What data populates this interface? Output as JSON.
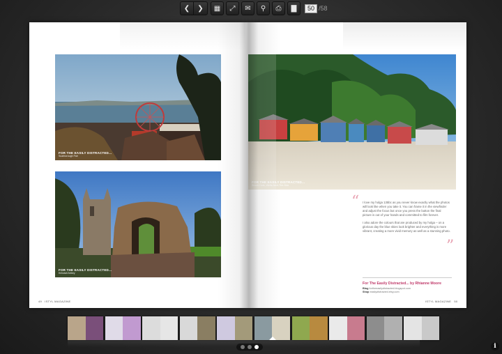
{
  "toolbar": {
    "prev_icon": "chevron-left-icon",
    "next_icon": "chevron-right-icon",
    "prev_glyph": "❮",
    "next_glyph": "❯",
    "grid_glyph": "▦",
    "fullscreen_glyph": "⤢",
    "email_glyph": "✉",
    "zoom_glyph": "⚲",
    "print_glyph": "⎙",
    "folder_glyph": "▇",
    "current_page": "50",
    "total_pages": "58"
  },
  "left_page": {
    "photo1_caption_title": "FOR THE EASILY DISTRACTED...",
    "photo1_caption_sub": "Scarborough Fair",
    "photo2_caption_title": "FOR THE EASILY DISTRACTED...",
    "photo2_caption_sub": "Kirkstall Abbey",
    "folio": "49",
    "magazine": "ISTYL MAGAZINE"
  },
  "right_page": {
    "photo_caption_title": "FOR THE EASILY DISTRACTED...",
    "photo_caption_sub": "Beach Huts, Wells-Next-The-Sea",
    "quote_open": "“",
    "quote_close": "”",
    "quote_p1": "I love my holga 135bc as you never know exactly what the photos will look like when you take it. You can frame it in the viewfinder and adjust the focus but once you press the button the final picture is out of your hands and committed to film forever.",
    "quote_p2": "I also adore the colours that are produced by my holga – on a glorious day the blue skies look brighter and everything is more vibrant, creating a more vivid memory as well as a stunning photo.",
    "byline": "For The Easily Distracted... by Rhianne Moore",
    "blog_label": "Blog",
    "blog_url": "fortheeasilydistracted.blogspot.com",
    "shop_label": "Shop",
    "shop_url": "easilydistracted.etsy.com",
    "magazine": "ISTYL MAGAZINE",
    "folio": "50"
  },
  "thumbnails": [
    {
      "left": "#b9a58a",
      "right": "#7a4f7a"
    },
    {
      "left": "#e0dbe8",
      "right": "#c19ad0"
    },
    {
      "left": "#dcdcdc",
      "right": "#e6e6e6"
    },
    {
      "left": "#d9d9d9",
      "right": "#8a7e62"
    },
    {
      "left": "#cfc9e0",
      "right": "#a39a7a"
    },
    {
      "left": "#8a9aa0",
      "right": "#d8d2c0",
      "selected": true
    },
    {
      "left": "#8fa84f",
      "right": "#b88a3f"
    },
    {
      "left": "#eaeaea",
      "right": "#c87b8e"
    },
    {
      "left": "#8d8d8d",
      "right": "#b0b0b0"
    },
    {
      "left": "#e4e4e4",
      "right": "#c9c9c9"
    }
  ],
  "pager_dots": [
    false,
    false,
    true
  ],
  "info_glyph": "i",
  "colors": {
    "accent_pink": "#c03a6a",
    "quote_pink": "#e8a3b3"
  }
}
